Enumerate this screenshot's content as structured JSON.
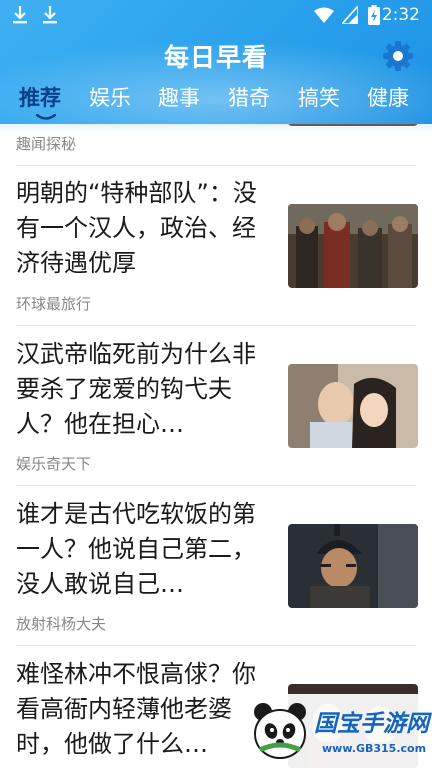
{
  "status_bar": {
    "time": "2:32"
  },
  "app": {
    "title": "每日早看"
  },
  "tabs": [
    {
      "label": "推荐",
      "active": true
    },
    {
      "label": "娱乐"
    },
    {
      "label": "趣事"
    },
    {
      "label": "猎奇"
    },
    {
      "label": "搞笑"
    },
    {
      "label": "健康"
    }
  ],
  "feed": {
    "top_source": "趣闻探秘",
    "articles": [
      {
        "title": "明朝的“特种部队”：没有一个汉人，政治、经济待遇优厚",
        "source": "环球最旅行",
        "thumb_icon": "soldiers-battle-image"
      },
      {
        "title": "汉武帝临死前为什么非要杀了宠爱的钩弋夫人？他在担心…",
        "source": "娱乐奇天下",
        "thumb_icon": "drama-couple-image"
      },
      {
        "title": "谁才是古代吃软饭的第一人？他说自己第二，没人敢说自己…",
        "source": "放射科杨大夫",
        "thumb_icon": "helmet-warrior-image"
      },
      {
        "title": "难怪林冲不恨高俅？你看高衙内轻薄他老婆时，他做了什么…",
        "source": "",
        "thumb_icon": "period-drama-image"
      }
    ]
  },
  "watermark": {
    "name": "国宝手游网",
    "url": "www.GB315.com"
  },
  "colors": {
    "header": "#29a1ec",
    "active_tab": "#0a3f8a",
    "source_text": "#888888",
    "title_text": "#1a1a1a"
  }
}
